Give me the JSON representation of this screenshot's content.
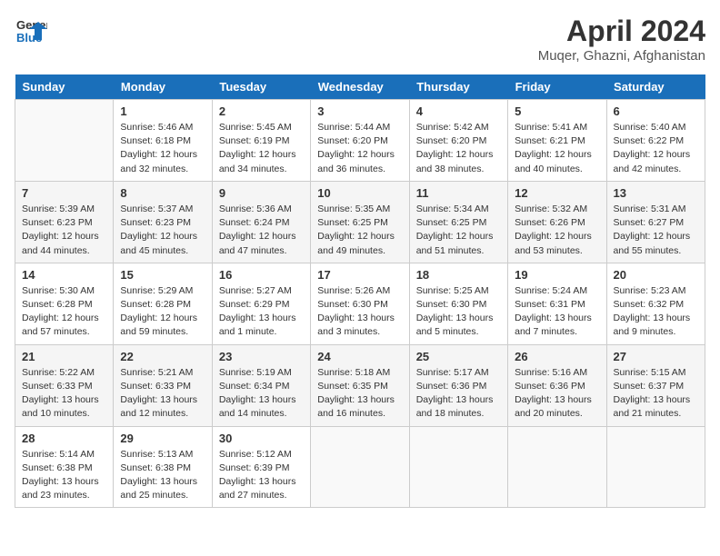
{
  "header": {
    "logo_line1": "General",
    "logo_line2": "Blue",
    "month": "April 2024",
    "location": "Muqer, Ghazni, Afghanistan"
  },
  "days_of_week": [
    "Sunday",
    "Monday",
    "Tuesday",
    "Wednesday",
    "Thursday",
    "Friday",
    "Saturday"
  ],
  "weeks": [
    [
      {
        "day": "",
        "info": ""
      },
      {
        "day": "1",
        "info": "Sunrise: 5:46 AM\nSunset: 6:18 PM\nDaylight: 12 hours\nand 32 minutes."
      },
      {
        "day": "2",
        "info": "Sunrise: 5:45 AM\nSunset: 6:19 PM\nDaylight: 12 hours\nand 34 minutes."
      },
      {
        "day": "3",
        "info": "Sunrise: 5:44 AM\nSunset: 6:20 PM\nDaylight: 12 hours\nand 36 minutes."
      },
      {
        "day": "4",
        "info": "Sunrise: 5:42 AM\nSunset: 6:20 PM\nDaylight: 12 hours\nand 38 minutes."
      },
      {
        "day": "5",
        "info": "Sunrise: 5:41 AM\nSunset: 6:21 PM\nDaylight: 12 hours\nand 40 minutes."
      },
      {
        "day": "6",
        "info": "Sunrise: 5:40 AM\nSunset: 6:22 PM\nDaylight: 12 hours\nand 42 minutes."
      }
    ],
    [
      {
        "day": "7",
        "info": "Sunrise: 5:39 AM\nSunset: 6:23 PM\nDaylight: 12 hours\nand 44 minutes."
      },
      {
        "day": "8",
        "info": "Sunrise: 5:37 AM\nSunset: 6:23 PM\nDaylight: 12 hours\nand 45 minutes."
      },
      {
        "day": "9",
        "info": "Sunrise: 5:36 AM\nSunset: 6:24 PM\nDaylight: 12 hours\nand 47 minutes."
      },
      {
        "day": "10",
        "info": "Sunrise: 5:35 AM\nSunset: 6:25 PM\nDaylight: 12 hours\nand 49 minutes."
      },
      {
        "day": "11",
        "info": "Sunrise: 5:34 AM\nSunset: 6:25 PM\nDaylight: 12 hours\nand 51 minutes."
      },
      {
        "day": "12",
        "info": "Sunrise: 5:32 AM\nSunset: 6:26 PM\nDaylight: 12 hours\nand 53 minutes."
      },
      {
        "day": "13",
        "info": "Sunrise: 5:31 AM\nSunset: 6:27 PM\nDaylight: 12 hours\nand 55 minutes."
      }
    ],
    [
      {
        "day": "14",
        "info": "Sunrise: 5:30 AM\nSunset: 6:28 PM\nDaylight: 12 hours\nand 57 minutes."
      },
      {
        "day": "15",
        "info": "Sunrise: 5:29 AM\nSunset: 6:28 PM\nDaylight: 12 hours\nand 59 minutes."
      },
      {
        "day": "16",
        "info": "Sunrise: 5:27 AM\nSunset: 6:29 PM\nDaylight: 13 hours\nand 1 minute."
      },
      {
        "day": "17",
        "info": "Sunrise: 5:26 AM\nSunset: 6:30 PM\nDaylight: 13 hours\nand 3 minutes."
      },
      {
        "day": "18",
        "info": "Sunrise: 5:25 AM\nSunset: 6:30 PM\nDaylight: 13 hours\nand 5 minutes."
      },
      {
        "day": "19",
        "info": "Sunrise: 5:24 AM\nSunset: 6:31 PM\nDaylight: 13 hours\nand 7 minutes."
      },
      {
        "day": "20",
        "info": "Sunrise: 5:23 AM\nSunset: 6:32 PM\nDaylight: 13 hours\nand 9 minutes."
      }
    ],
    [
      {
        "day": "21",
        "info": "Sunrise: 5:22 AM\nSunset: 6:33 PM\nDaylight: 13 hours\nand 10 minutes."
      },
      {
        "day": "22",
        "info": "Sunrise: 5:21 AM\nSunset: 6:33 PM\nDaylight: 13 hours\nand 12 minutes."
      },
      {
        "day": "23",
        "info": "Sunrise: 5:19 AM\nSunset: 6:34 PM\nDaylight: 13 hours\nand 14 minutes."
      },
      {
        "day": "24",
        "info": "Sunrise: 5:18 AM\nSunset: 6:35 PM\nDaylight: 13 hours\nand 16 minutes."
      },
      {
        "day": "25",
        "info": "Sunrise: 5:17 AM\nSunset: 6:36 PM\nDaylight: 13 hours\nand 18 minutes."
      },
      {
        "day": "26",
        "info": "Sunrise: 5:16 AM\nSunset: 6:36 PM\nDaylight: 13 hours\nand 20 minutes."
      },
      {
        "day": "27",
        "info": "Sunrise: 5:15 AM\nSunset: 6:37 PM\nDaylight: 13 hours\nand 21 minutes."
      }
    ],
    [
      {
        "day": "28",
        "info": "Sunrise: 5:14 AM\nSunset: 6:38 PM\nDaylight: 13 hours\nand 23 minutes."
      },
      {
        "day": "29",
        "info": "Sunrise: 5:13 AM\nSunset: 6:38 PM\nDaylight: 13 hours\nand 25 minutes."
      },
      {
        "day": "30",
        "info": "Sunrise: 5:12 AM\nSunset: 6:39 PM\nDaylight: 13 hours\nand 27 minutes."
      },
      {
        "day": "",
        "info": ""
      },
      {
        "day": "",
        "info": ""
      },
      {
        "day": "",
        "info": ""
      },
      {
        "day": "",
        "info": ""
      }
    ]
  ]
}
